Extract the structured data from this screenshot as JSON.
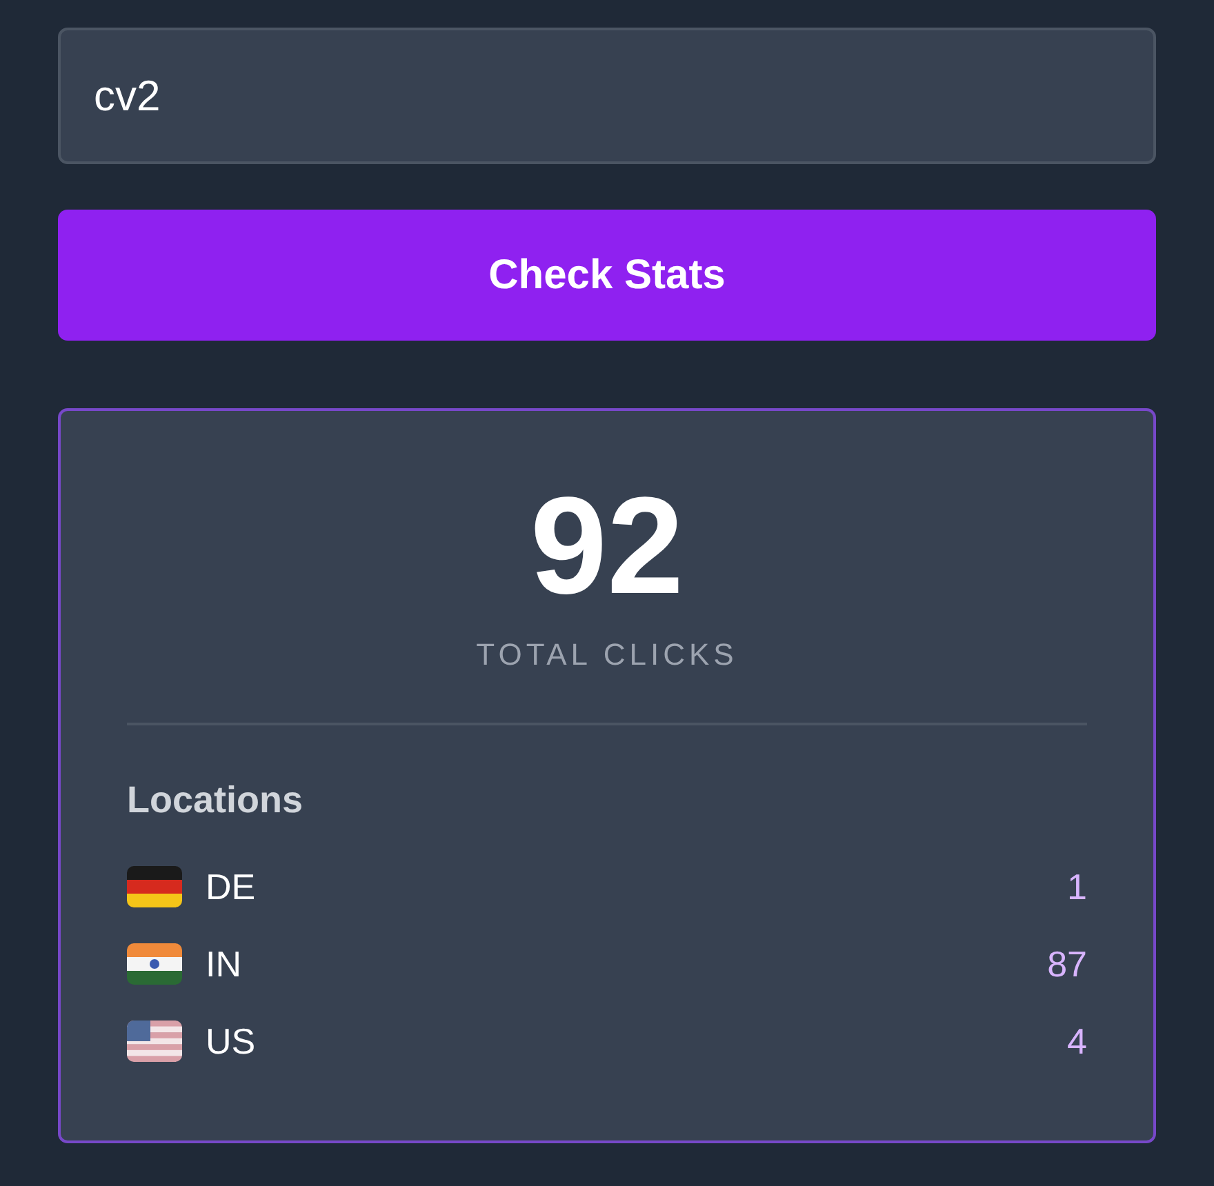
{
  "search": {
    "value": "cv2"
  },
  "check_button": {
    "label": "Check Stats"
  },
  "stats": {
    "total": "92",
    "total_label": "TOTAL CLICKS",
    "locations_title": "Locations",
    "locations": [
      {
        "kind": "germany",
        "code": "DE",
        "count": "1"
      },
      {
        "kind": "india",
        "code": "IN",
        "count": "87"
      },
      {
        "kind": "usa",
        "code": "US",
        "count": "4"
      }
    ]
  }
}
